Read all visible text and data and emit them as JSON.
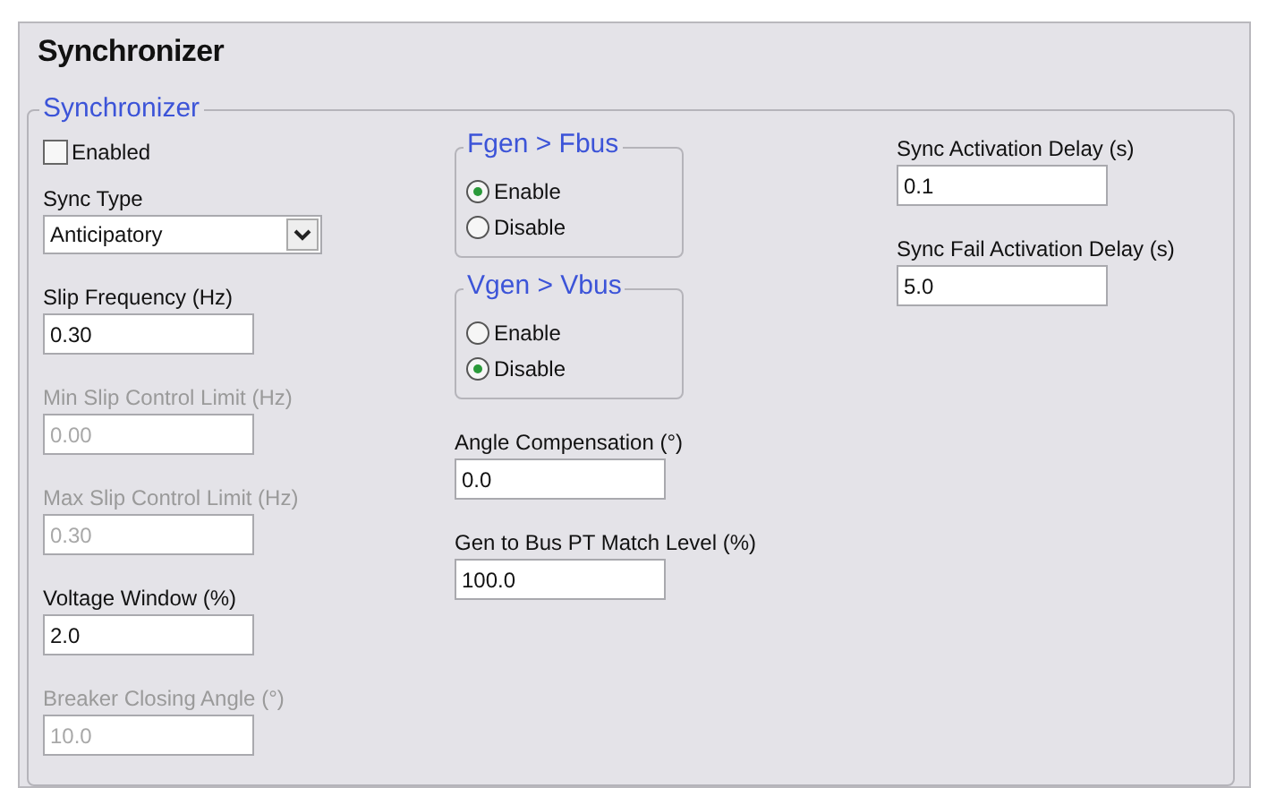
{
  "title": "Synchronizer",
  "group": {
    "legend": "Synchronizer",
    "columns": [
      [
        {
          "kind": "checkbox",
          "label": "Enabled",
          "checked": false
        },
        {
          "kind": "select",
          "label": "Sync Type",
          "value": "Anticipatory"
        },
        {
          "kind": "field",
          "label": "Slip Frequency (Hz)",
          "value": "0.30",
          "disabled": false
        },
        {
          "kind": "field",
          "label": "Min Slip Control Limit (Hz)",
          "value": "0.00",
          "disabled": true
        },
        {
          "kind": "field",
          "label": "Max Slip Control Limit (Hz)",
          "value": "0.30",
          "disabled": true
        },
        {
          "kind": "field",
          "label": "Voltage Window (%)",
          "value": "2.0",
          "disabled": false
        },
        {
          "kind": "field",
          "label": "Breaker Closing Angle (°)",
          "value": "10.0",
          "disabled": true
        }
      ],
      [
        {
          "kind": "radiogroup",
          "legend": "Fgen > Fbus",
          "options": [
            {
              "label": "Enable",
              "selected": true
            },
            {
              "label": "Disable",
              "selected": false
            }
          ]
        },
        {
          "kind": "radiogroup",
          "legend": "Vgen > Vbus",
          "options": [
            {
              "label": "Enable",
              "selected": false
            },
            {
              "label": "Disable",
              "selected": true
            }
          ]
        },
        {
          "kind": "field",
          "label": "Angle Compensation (°)",
          "value": "0.0",
          "disabled": false
        },
        {
          "kind": "field",
          "label": "Gen to Bus PT Match Level (%)",
          "value": "100.0",
          "disabled": false
        }
      ],
      [
        {
          "kind": "field",
          "label": "Sync Activation Delay (s)",
          "value": "0.1",
          "disabled": false
        },
        {
          "kind": "field",
          "label": "Sync Fail Activation Delay (s)",
          "value": "5.0",
          "disabled": false
        }
      ]
    ]
  }
}
